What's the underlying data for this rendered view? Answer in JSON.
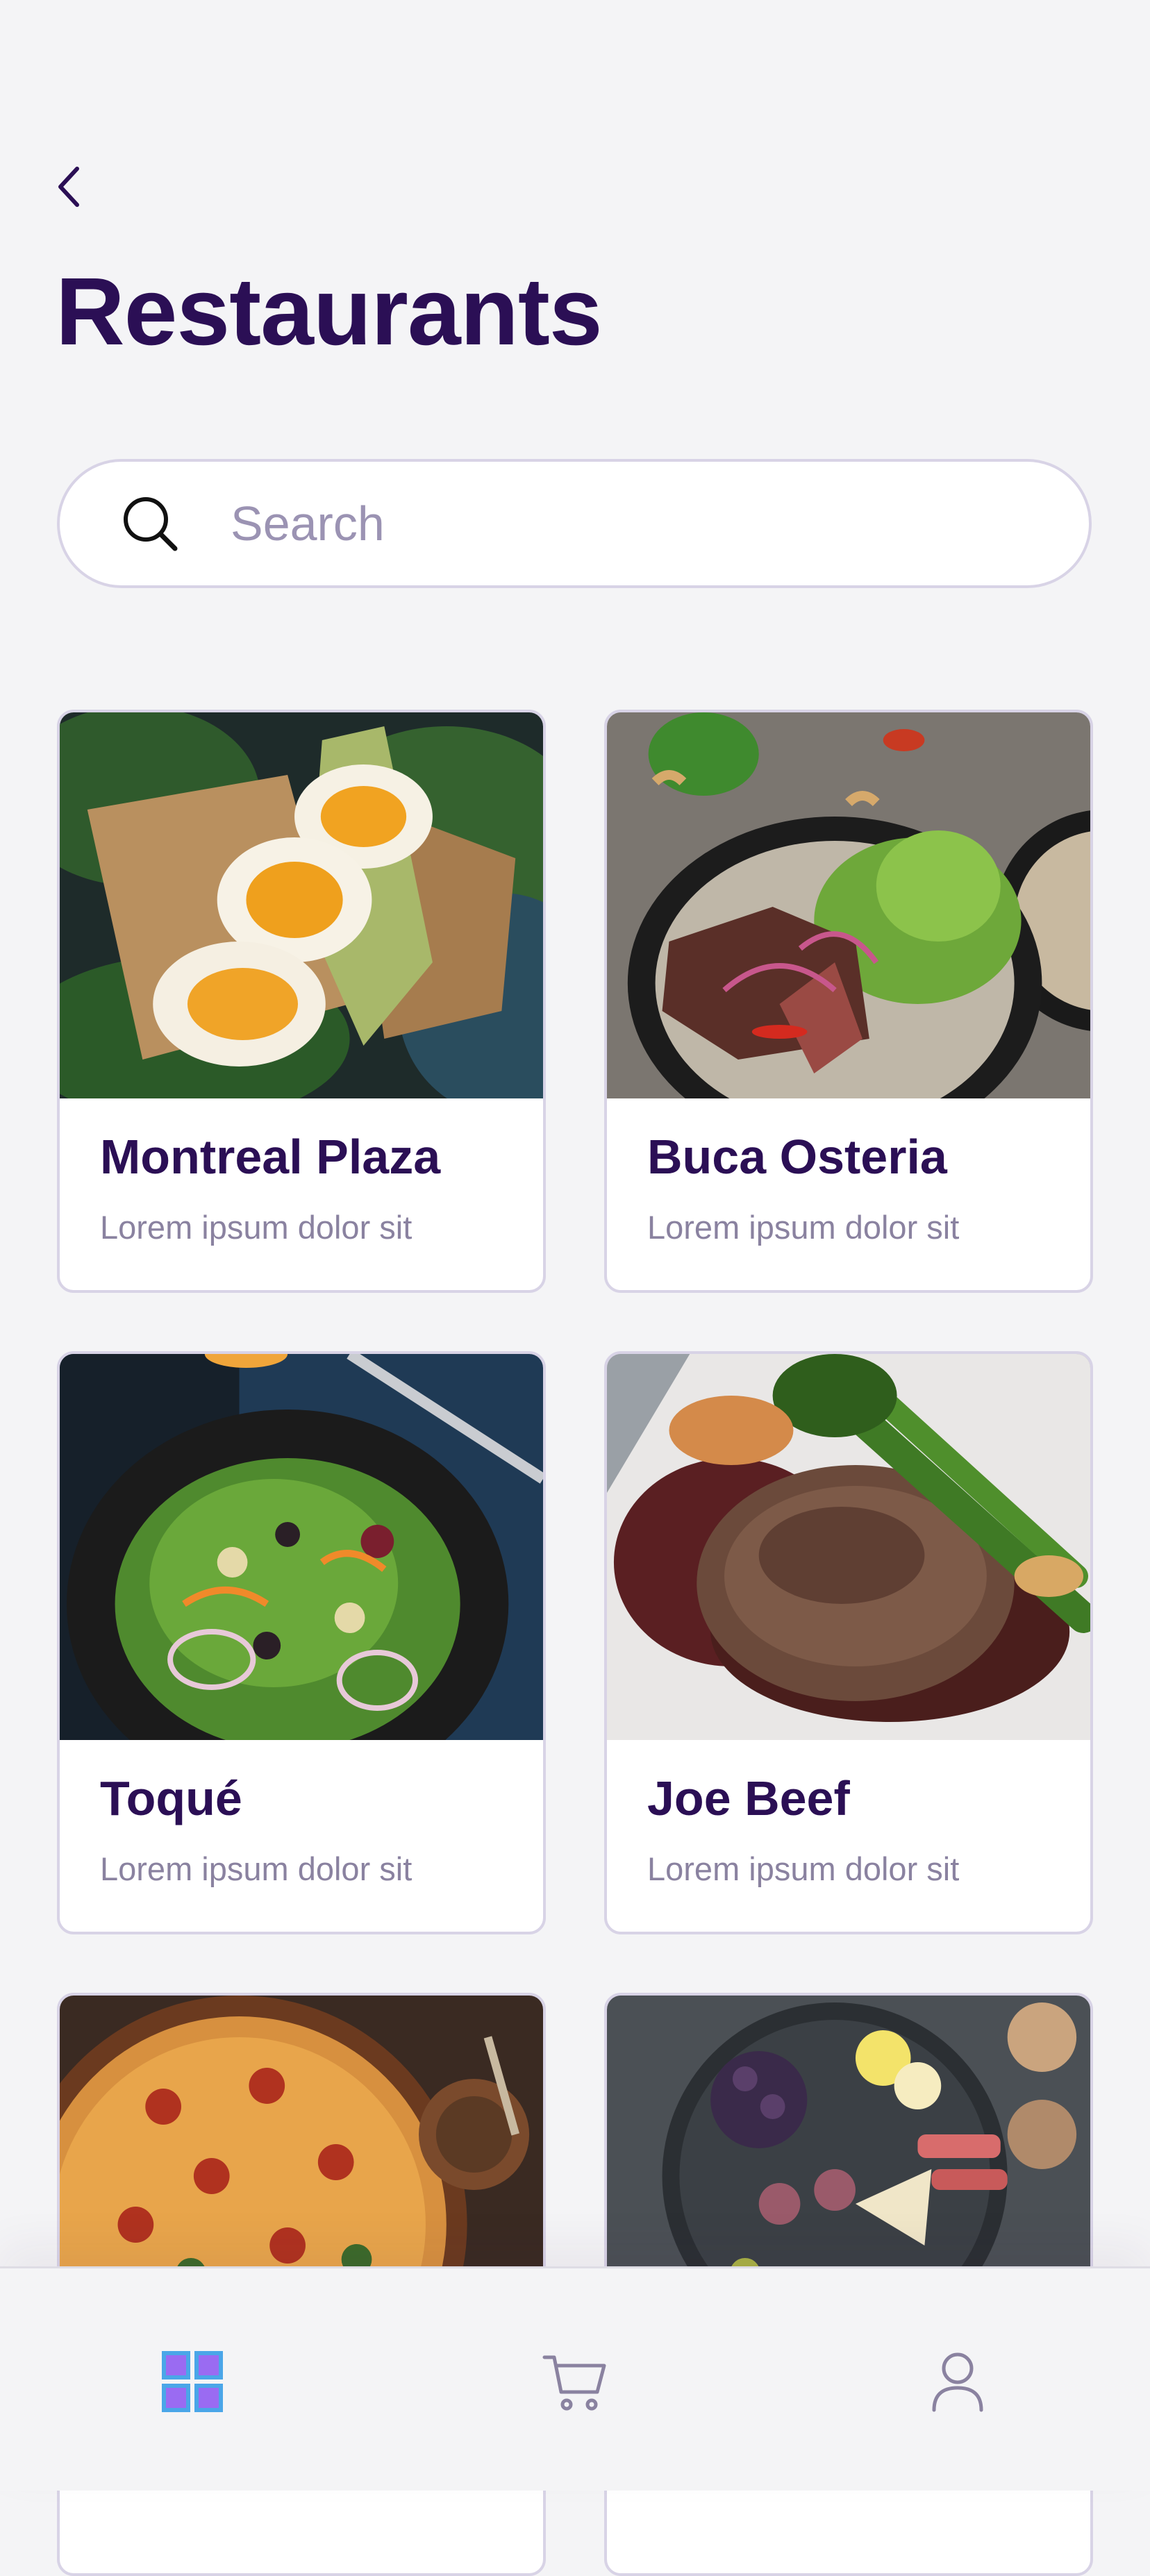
{
  "header": {
    "back_icon": "chevron-left-icon",
    "title": "Restaurants"
  },
  "search": {
    "icon": "search-icon",
    "placeholder": "Search",
    "value": ""
  },
  "restaurants": [
    {
      "name": "Montreal Plaza",
      "description": "Lorem ipsum dolor sit",
      "photo": "eggs-avocado-toast"
    },
    {
      "name": "Buca Osteria",
      "description": "Lorem ipsum dolor sit",
      "photo": "steak-salad-bowl"
    },
    {
      "name": "Toqué",
      "description": "Lorem ipsum dolor sit",
      "photo": "green-salad-bowl"
    },
    {
      "name": "Joe Beef",
      "description": "Lorem ipsum dolor sit",
      "photo": "steak-broccolini"
    },
    {
      "name": "",
      "description": "",
      "photo": "pizza"
    },
    {
      "name": "",
      "description": "",
      "photo": "cheese-fruit-platter"
    }
  ],
  "tabbar": {
    "items": [
      {
        "icon": "grid-icon",
        "active": true
      },
      {
        "icon": "cart-icon",
        "active": false
      },
      {
        "icon": "user-icon",
        "active": false
      }
    ]
  },
  "colors": {
    "title": "#2b0f55",
    "accent_purple": "#9a6bf2",
    "accent_blue": "#4aa6e8",
    "muted": "#8a82a0",
    "border": "#d8d3e6",
    "background": "#f4f4f6"
  }
}
